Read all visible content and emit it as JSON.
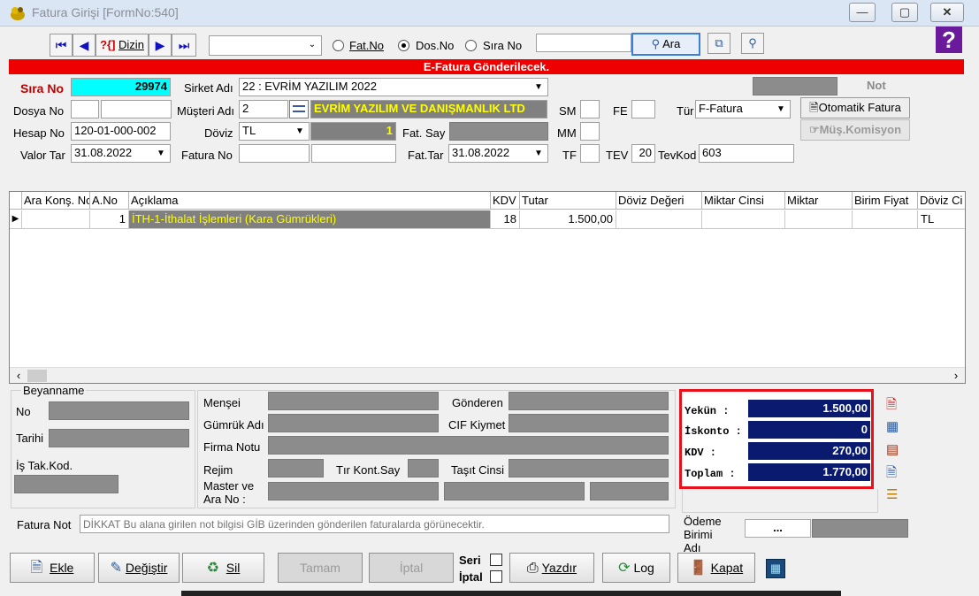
{
  "window": {
    "title": "Fatura Girişi [FormNo:540]"
  },
  "toolbar": {
    "dizin_label": "Dizin",
    "radio_fatno": "Fat.No",
    "radio_dosno": "Dos.No",
    "radio_sirano": "Sıra No",
    "ara_label": "Ara"
  },
  "banner": "E-Fatura Gönderilecek.",
  "header": {
    "sira_no_label": "Sıra No",
    "sira_no": "29974",
    "sirket_adi_label": "Sirket Adı",
    "sirket_adi": "22 : EVRİM YAZILIM  2022",
    "not_label": "Not",
    "dosya_no_label": "Dosya No",
    "musteri_adi_label": "Müşteri Adı",
    "musteri_kod": "2",
    "musteri_adi": "EVRİM YAZILIM VE DANIŞMANLIK LTD",
    "sm_label": "SM",
    "fe_label": "FE",
    "tur_label": "Tür",
    "tur": "F-Fatura",
    "otomatik_fatura": "Otomatik Fatura",
    "mus_komisyon": "Müş.Komisyon",
    "hesap_no_label": "Hesap No",
    "hesap_no": "120-01-000-002",
    "doviz_label": "Döviz",
    "doviz": "TL",
    "kur": "1",
    "fat_say_label": "Fat. Say",
    "mm_label": "MM",
    "valor_tar_label": "Valor Tar",
    "valor_tar": "31.08.2022",
    "fatura_no_label": "Fatura No",
    "fat_tar_label": "Fat.Tar",
    "fat_tar": "31.08.2022",
    "tf_label": "TF",
    "tev_label": "TEV",
    "tev": "20",
    "tevkod_label": "TevKod",
    "tevkod": "603"
  },
  "grid": {
    "columns": [
      "Ara Konş. No",
      "A.No",
      "Açıklama",
      "KDV",
      "Tutar",
      "Döviz Değeri",
      "Miktar Cinsi",
      "Miktar",
      "Birim Fiyat",
      "Döviz Ci"
    ],
    "rows": [
      {
        "ano": "1",
        "aciklama": "İTH-1-İthalat İşlemleri  (Kara Gümrükleri)",
        "kdv": "18",
        "tutar": "1.500,00",
        "doviz": "TL"
      }
    ]
  },
  "beyanname": {
    "group_label": "Beyanname",
    "no_label": "No",
    "tarihi_label": "Tarihi",
    "is_tak_label": "İş Tak.Kod.",
    "mensei_label": "Menşei",
    "gonderen_label": "Gönderen",
    "gumruk_adi_label": "Gümrük Adı",
    "cif_label": "CIF Kiymet",
    "firma_notu_label": "Firma Notu",
    "rejim_label": "Rejim",
    "tir_kont_label": "Tır Kont.Say",
    "tasit_label": "Taşıt Cinsi",
    "master_label_1": "Master ve",
    "master_label_2": "Ara No :"
  },
  "totals": {
    "yekun_label": "Yekün     :",
    "yekun": "1.500,00",
    "iskonto_label": "İskonto  :",
    "iskonto": "0",
    "kdv_label": "KDV       :",
    "kdv": "270,00",
    "toplam_label": "Toplam  :",
    "toplam": "1.770,00"
  },
  "footer": {
    "fatura_not_label": "Fatura Not",
    "fatura_not_placeholder": "DİKKAT Bu alana girilen not bilgisi GİB üzerinden gönderilen faturalarda görünecektir.",
    "odeme_label_1": "Ödeme",
    "odeme_label_2": "Birimi",
    "odeme_label_3": "Adı",
    "odeme_btn": "..."
  },
  "buttons": {
    "ekle": "Ekle",
    "degistir": "Değiştir",
    "sil": "Sil",
    "tamam": "Tamam",
    "iptal": "İptal",
    "seri_label": "Seri",
    "iptal_label": "İptal",
    "yazdir": "Yazdır",
    "log": "Log",
    "kapat": "Kapat"
  },
  "colors": {
    "banner": "#ee0000",
    "sira_no_bg": "#00ffff",
    "musteri_bg": "#808080",
    "musteri_text": "#ffff00",
    "totals_bg": "#0a1a6e",
    "highlight_border": "#e8101a"
  }
}
